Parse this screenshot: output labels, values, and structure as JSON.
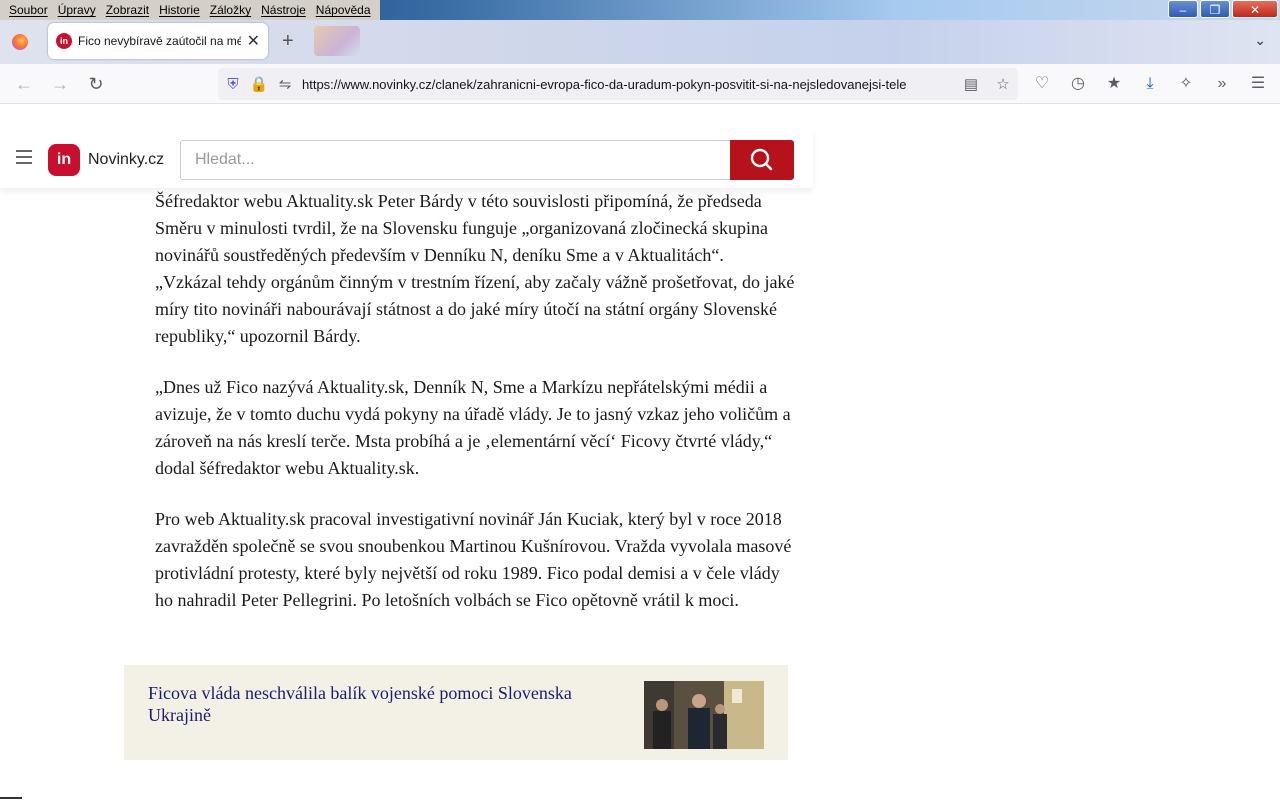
{
  "menubar": [
    "Soubor",
    "Úpravy",
    "Zobrazit",
    "Historie",
    "Záložky",
    "Nástroje",
    "Nápověda"
  ],
  "tab": {
    "favicon_text": "in",
    "title": "Fico nevybíravě zaútočil na médi"
  },
  "address_bar": {
    "url": "https://www.novinky.cz/clanek/zahranicni-evropa-fico-da-uradum-pokyn-posvitit-si-na-nejsledovanejsi-tele"
  },
  "site": {
    "logo_text": "in",
    "name": "Novinky.cz",
    "search_placeholder": "Hledat...",
    "brand_color": "#c8102e",
    "search_button_color": "#b5121b"
  },
  "article": {
    "paragraphs": [
      "Šéfredaktor webu Aktuality.sk Peter Bárdy v této souvislosti připomíná, že předseda Směru v minulosti tvrdil, že na Slovensku funguje „organizovaná zločinecká skupina novinářů soustředěných především v Denníku N, deníku Sme a v Aktualitách“. „Vzkázal tehdy orgánům činným v trestním řízení, aby začaly vážně prošetřovat, do jaké míry tito novináři nabourávají státnost a do jaké míry útočí na státní orgány Slovenské republiky,“ upozornil Bárdy.",
      "„Dnes už Fico nazývá Aktuality.sk, Denník N, Sme a Markízu nepřátelskými médii a avizuje, že v tomto duchu vydá pokyny na úřadě vlády. Je to jasný vzkaz jeho voličům a zároveň na nás kreslí terče. Msta probíhá a je ‚elementární věcí‘ Ficovy čtvrté vlády,“ dodal šéfredaktor webu Aktuality.sk.",
      "Pro web Aktuality.sk pracoval investigativní novinář Ján Kuciak, který byl v roce 2018 zavražděn společně se svou snoubenkou Martinou Kušnírovou. Vražda vyvolala masové protivládní protesty, které byly největší od roku 1989. Fico podal demisi a v čele vlády ho nahradil Peter Pellegrini. Po letošních volbách se Fico opětovně vrátil k moci."
    ]
  },
  "related": {
    "title": "Ficova vláda neschválila balík vojenské pomoci Slovenska Ukrajině"
  }
}
